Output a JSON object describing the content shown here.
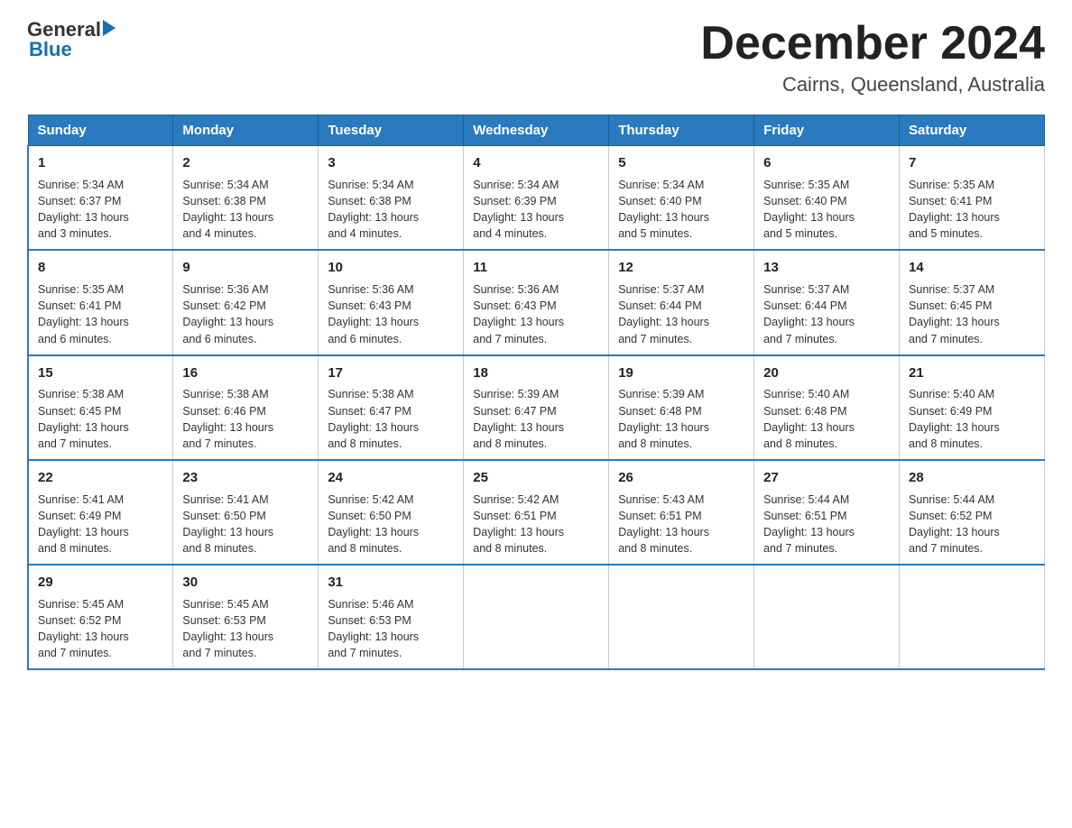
{
  "header": {
    "logo_general": "General",
    "logo_blue": "Blue",
    "title": "December 2024",
    "subtitle": "Cairns, Queensland, Australia"
  },
  "weekdays": [
    "Sunday",
    "Monday",
    "Tuesday",
    "Wednesday",
    "Thursday",
    "Friday",
    "Saturday"
  ],
  "weeks": [
    [
      {
        "day": "1",
        "sunrise": "5:34 AM",
        "sunset": "6:37 PM",
        "daylight": "13 hours and 3 minutes."
      },
      {
        "day": "2",
        "sunrise": "5:34 AM",
        "sunset": "6:38 PM",
        "daylight": "13 hours and 4 minutes."
      },
      {
        "day": "3",
        "sunrise": "5:34 AM",
        "sunset": "6:38 PM",
        "daylight": "13 hours and 4 minutes."
      },
      {
        "day": "4",
        "sunrise": "5:34 AM",
        "sunset": "6:39 PM",
        "daylight": "13 hours and 4 minutes."
      },
      {
        "day": "5",
        "sunrise": "5:34 AM",
        "sunset": "6:40 PM",
        "daylight": "13 hours and 5 minutes."
      },
      {
        "day": "6",
        "sunrise": "5:35 AM",
        "sunset": "6:40 PM",
        "daylight": "13 hours and 5 minutes."
      },
      {
        "day": "7",
        "sunrise": "5:35 AM",
        "sunset": "6:41 PM",
        "daylight": "13 hours and 5 minutes."
      }
    ],
    [
      {
        "day": "8",
        "sunrise": "5:35 AM",
        "sunset": "6:41 PM",
        "daylight": "13 hours and 6 minutes."
      },
      {
        "day": "9",
        "sunrise": "5:36 AM",
        "sunset": "6:42 PM",
        "daylight": "13 hours and 6 minutes."
      },
      {
        "day": "10",
        "sunrise": "5:36 AM",
        "sunset": "6:43 PM",
        "daylight": "13 hours and 6 minutes."
      },
      {
        "day": "11",
        "sunrise": "5:36 AM",
        "sunset": "6:43 PM",
        "daylight": "13 hours and 7 minutes."
      },
      {
        "day": "12",
        "sunrise": "5:37 AM",
        "sunset": "6:44 PM",
        "daylight": "13 hours and 7 minutes."
      },
      {
        "day": "13",
        "sunrise": "5:37 AM",
        "sunset": "6:44 PM",
        "daylight": "13 hours and 7 minutes."
      },
      {
        "day": "14",
        "sunrise": "5:37 AM",
        "sunset": "6:45 PM",
        "daylight": "13 hours and 7 minutes."
      }
    ],
    [
      {
        "day": "15",
        "sunrise": "5:38 AM",
        "sunset": "6:45 PM",
        "daylight": "13 hours and 7 minutes."
      },
      {
        "day": "16",
        "sunrise": "5:38 AM",
        "sunset": "6:46 PM",
        "daylight": "13 hours and 7 minutes."
      },
      {
        "day": "17",
        "sunrise": "5:38 AM",
        "sunset": "6:47 PM",
        "daylight": "13 hours and 8 minutes."
      },
      {
        "day": "18",
        "sunrise": "5:39 AM",
        "sunset": "6:47 PM",
        "daylight": "13 hours and 8 minutes."
      },
      {
        "day": "19",
        "sunrise": "5:39 AM",
        "sunset": "6:48 PM",
        "daylight": "13 hours and 8 minutes."
      },
      {
        "day": "20",
        "sunrise": "5:40 AM",
        "sunset": "6:48 PM",
        "daylight": "13 hours and 8 minutes."
      },
      {
        "day": "21",
        "sunrise": "5:40 AM",
        "sunset": "6:49 PM",
        "daylight": "13 hours and 8 minutes."
      }
    ],
    [
      {
        "day": "22",
        "sunrise": "5:41 AM",
        "sunset": "6:49 PM",
        "daylight": "13 hours and 8 minutes."
      },
      {
        "day": "23",
        "sunrise": "5:41 AM",
        "sunset": "6:50 PM",
        "daylight": "13 hours and 8 minutes."
      },
      {
        "day": "24",
        "sunrise": "5:42 AM",
        "sunset": "6:50 PM",
        "daylight": "13 hours and 8 minutes."
      },
      {
        "day": "25",
        "sunrise": "5:42 AM",
        "sunset": "6:51 PM",
        "daylight": "13 hours and 8 minutes."
      },
      {
        "day": "26",
        "sunrise": "5:43 AM",
        "sunset": "6:51 PM",
        "daylight": "13 hours and 8 minutes."
      },
      {
        "day": "27",
        "sunrise": "5:44 AM",
        "sunset": "6:51 PM",
        "daylight": "13 hours and 7 minutes."
      },
      {
        "day": "28",
        "sunrise": "5:44 AM",
        "sunset": "6:52 PM",
        "daylight": "13 hours and 7 minutes."
      }
    ],
    [
      {
        "day": "29",
        "sunrise": "5:45 AM",
        "sunset": "6:52 PM",
        "daylight": "13 hours and 7 minutes."
      },
      {
        "day": "30",
        "sunrise": "5:45 AM",
        "sunset": "6:53 PM",
        "daylight": "13 hours and 7 minutes."
      },
      {
        "day": "31",
        "sunrise": "5:46 AM",
        "sunset": "6:53 PM",
        "daylight": "13 hours and 7 minutes."
      },
      null,
      null,
      null,
      null
    ]
  ],
  "labels": {
    "sunrise": "Sunrise:",
    "sunset": "Sunset:",
    "daylight": "Daylight:"
  }
}
